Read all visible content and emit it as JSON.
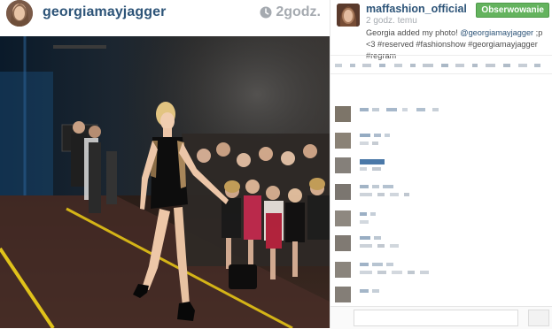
{
  "post": {
    "username": "georgiamayjagger",
    "time": "2godz.",
    "clock_icon": "clock-icon",
    "photo_description_icon": "runway-photo"
  },
  "comment_panel": {
    "username": "maffashion_official",
    "time": "2 godz. temu",
    "follow_button": "Obserwowanie",
    "follow_color": "#64b35e",
    "username_color": "#2d5478",
    "caption_prefix": "Georgia added my photo! ",
    "caption_mention": "@georgiamayjagger",
    "caption_suffix": " ;p <3 #reserved #fashionshow #georgiamayjagger #regram"
  },
  "colors": {
    "link": "#2d5478",
    "muted": "#a5aab0",
    "follow_green": "#64b35e"
  }
}
